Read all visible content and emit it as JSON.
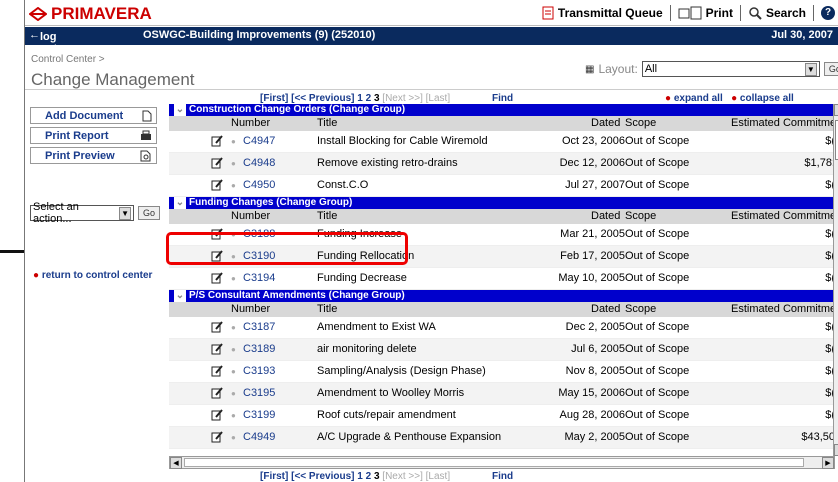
{
  "header": {
    "logo": "PRIMAVERA",
    "transmittal": "Transmittal Queue",
    "print": "Print",
    "search": "Search"
  },
  "navbar": {
    "logout": "log out",
    "project": "OSWGC-Building Improvements (9) (252010)",
    "date": "Jul 30, 2007"
  },
  "page": {
    "breadcrumb": "Control Center >",
    "title": "Change Management",
    "layout_label": "Layout:",
    "layout_value": "All",
    "go": "Go"
  },
  "left": {
    "add_document": "Add Document",
    "print_report": "Print Report",
    "print_preview": "Print Preview",
    "action_placeholder": "Select an action...",
    "go": "Go",
    "return_link": "return to control center"
  },
  "pager": {
    "first": "[First]",
    "prev": "[<< Previous]",
    "p1": "1",
    "p2": "2",
    "p3": "3",
    "next": "[Next >>]",
    "last": "[Last]",
    "find": "Find"
  },
  "controls": {
    "expand_all": "expand all",
    "collapse_all": "collapse all"
  },
  "columns": {
    "number": "Number",
    "title": "Title",
    "dated": "Dated",
    "scope": "Scope",
    "estimated": "Estimated Commitme"
  },
  "groups": [
    {
      "name": "Construction Change Orders (Change Group)",
      "rows": [
        {
          "number": "C4947",
          "title": "Install Blocking for Cable Wiremold",
          "dated": "Oct 23, 2006",
          "scope": "Out of Scope",
          "est": "$("
        },
        {
          "number": "C4948",
          "title": "Remove existing retro-drains",
          "dated": "Dec 12, 2006",
          "scope": "Out of Scope",
          "est": "$1,78:"
        },
        {
          "number": "C4950",
          "title": "Const.C.O",
          "dated": "Jul 27, 2007",
          "scope": "Out of Scope",
          "est": "$("
        }
      ]
    },
    {
      "name": "Funding Changes (Change Group)",
      "rows": [
        {
          "number": "C3188",
          "title": "Funding Increase",
          "dated": "Mar 21, 2005",
          "scope": "Out of Scope",
          "est": "$("
        },
        {
          "number": "C3190",
          "title": "Funding Rellocation",
          "dated": "Feb 17, 2005",
          "scope": "Out of Scope",
          "est": "$("
        },
        {
          "number": "C3194",
          "title": "Funding Decrease",
          "dated": "May 10, 2005",
          "scope": "Out of Scope",
          "est": "$("
        }
      ]
    },
    {
      "name": "P/S Consultant Amendments (Change Group)",
      "rows": [
        {
          "number": "C3187",
          "title": "Amendment to Exist WA",
          "dated": "Dec 2, 2005",
          "scope": "Out of Scope",
          "est": "$("
        },
        {
          "number": "C3189",
          "title": "air monitoring delete",
          "dated": "Jul 6, 2005",
          "scope": "Out of Scope",
          "est": "$("
        },
        {
          "number": "C3193",
          "title": "Sampling/Analysis (Design Phase)",
          "dated": "Nov 8, 2005",
          "scope": "Out of Scope",
          "est": "$("
        },
        {
          "number": "C3195",
          "title": "Amendment to Woolley Morris",
          "dated": "May 15, 2006",
          "scope": "Out of Scope",
          "est": "$("
        },
        {
          "number": "C3199",
          "title": "Roof cuts/repair amendment",
          "dated": "Aug 28, 2006",
          "scope": "Out of Scope",
          "est": "$("
        },
        {
          "number": "C4949",
          "title": "A/C Upgrade & Penthouse Expansion",
          "dated": "May 2, 2005",
          "scope": "Out of Scope",
          "est": "$43,50"
        }
      ]
    }
  ]
}
